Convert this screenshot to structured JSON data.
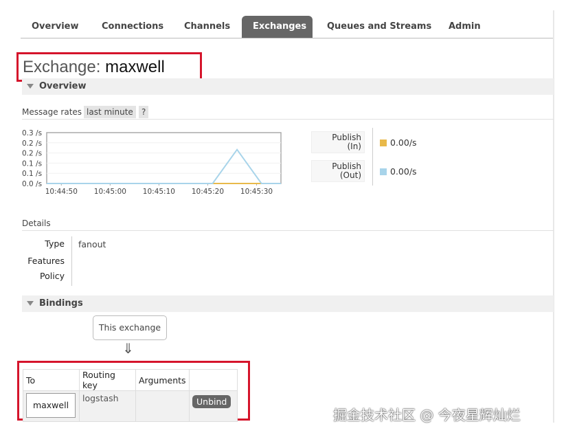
{
  "nav": {
    "tabs": [
      {
        "label": "Overview"
      },
      {
        "label": "Connections"
      },
      {
        "label": "Channels"
      },
      {
        "label": "Exchanges"
      },
      {
        "label": "Queues and Streams"
      },
      {
        "label": "Admin"
      }
    ],
    "active": "Exchanges"
  },
  "page": {
    "title_prefix": "Exchange:",
    "title_name": "maxwell"
  },
  "overview": {
    "header": "Overview",
    "message_rates_label": "Message rates",
    "range_chip": "last minute",
    "help_chip": "?"
  },
  "chart_data": {
    "type": "line",
    "y_tick_labels": [
      "0.3 /s",
      "0.2 /s",
      "0.2 /s",
      "0.1 /s",
      "0.1 /s",
      "0.0 /s"
    ],
    "x_tick_labels": [
      "10:44:50",
      "10:45:00",
      "10:45:10",
      "10:45:20",
      "10:45:30"
    ],
    "ylim": [
      0,
      0.3
    ],
    "grid": true,
    "series": [
      {
        "name": "Publish (In)",
        "color": "#e8b94a",
        "x": [
          "10:44:47",
          "10:45:35"
        ],
        "values": [
          0,
          0
        ]
      },
      {
        "name": "Publish (Out)",
        "color": "#a8d4ea",
        "x": [
          "10:44:47",
          "10:45:21",
          "10:45:26",
          "10:45:31",
          "10:45:35"
        ],
        "values": [
          0,
          0,
          0.2,
          0,
          0
        ]
      }
    ]
  },
  "legend": [
    {
      "line1": "Publish",
      "line2": "(In)",
      "value": "0.00/s",
      "color": "#e8b94a"
    },
    {
      "line1": "Publish",
      "line2": "(Out)",
      "value": "0.00/s",
      "color": "#a8d4ea"
    }
  ],
  "details": {
    "label": "Details",
    "type_key": "Type",
    "type_value": "fanout",
    "features_key": "Features",
    "policy_key": "Policy"
  },
  "bindings": {
    "header": "Bindings",
    "this_exchange": "This exchange",
    "arrow": "⇓",
    "columns": {
      "to": "To",
      "routing_key": "Routing key",
      "arguments": "Arguments"
    },
    "row": {
      "to": "maxwell",
      "routing_key": "logstash",
      "arguments": "",
      "unbind_label": "Unbind"
    }
  },
  "watermark": "掘金技术社区 @ 今夜星辉灿烂"
}
